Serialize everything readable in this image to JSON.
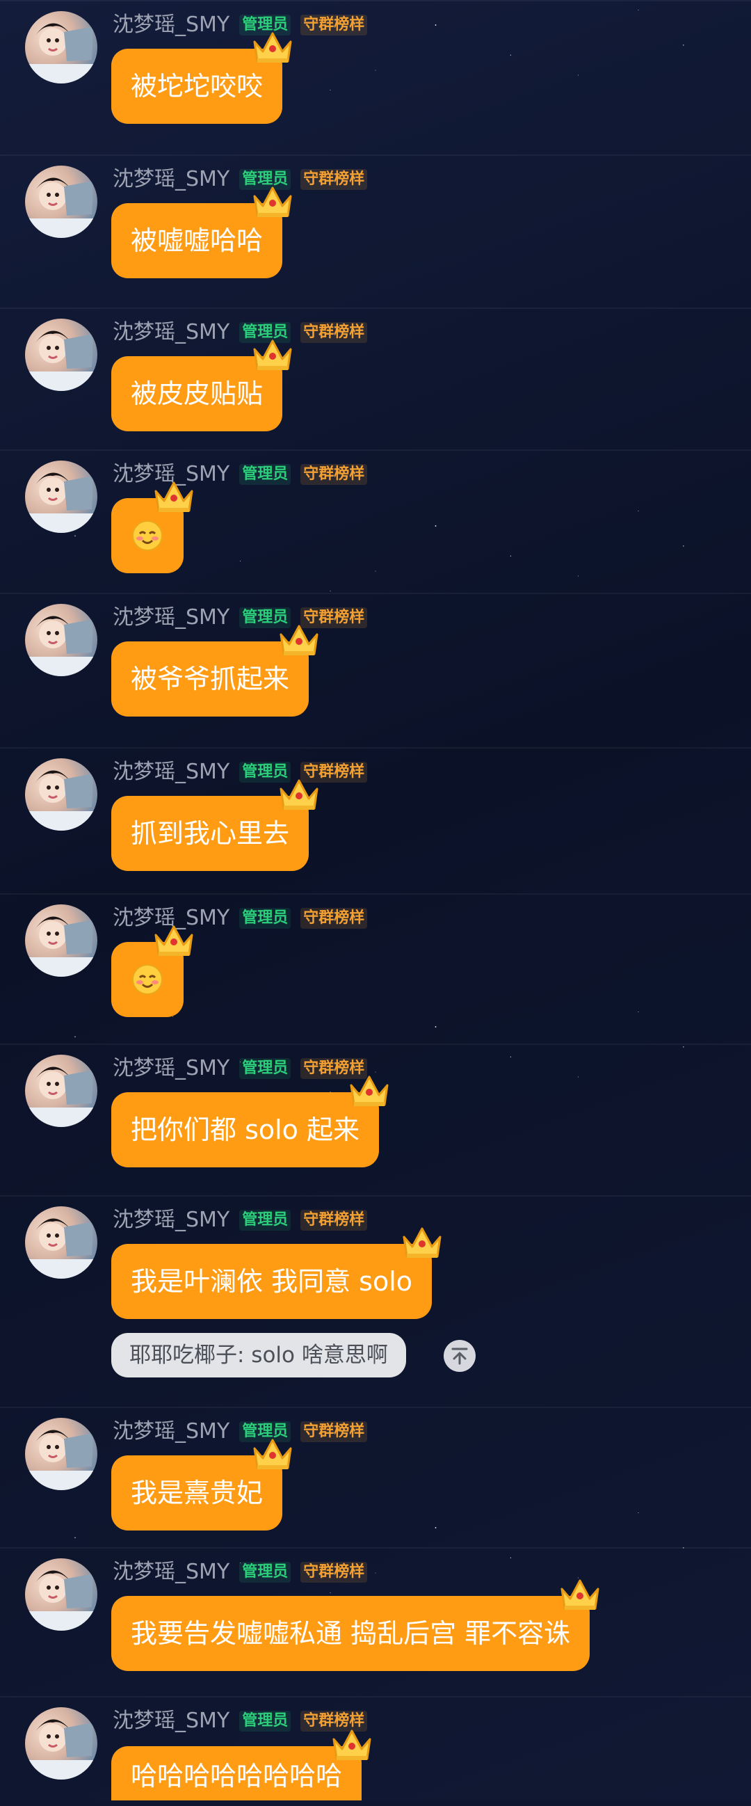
{
  "sender": {
    "name": "沈梦瑶_SMY",
    "badge_admin": "管理员",
    "badge_guard": "守群榜样"
  },
  "messages": [
    {
      "text": "被坨坨咬咬",
      "emoji": null
    },
    {
      "text": "被嘘嘘哈哈",
      "emoji": null
    },
    {
      "text": "被皮皮贴贴",
      "emoji": null
    },
    {
      "text": "",
      "emoji": "smiling-blush-emoji"
    },
    {
      "text": "被爷爷抓起来",
      "emoji": null
    },
    {
      "text": "抓到我心里去",
      "emoji": null
    },
    {
      "text": "",
      "emoji": "smiling-blush-emoji"
    },
    {
      "text": "把你们都 solo 起来",
      "emoji": null
    },
    {
      "text": "我是叶澜依 我同意 solo",
      "emoji": null
    },
    {
      "text": "我是熹贵妃",
      "emoji": null
    },
    {
      "text": "我要告发嘘嘘私通 捣乱后宫 罪不容诛",
      "emoji": null
    },
    {
      "text": "哈哈哈哈哈哈哈哈",
      "emoji": null
    }
  ],
  "reply": {
    "text": "耶耶吃椰子: solo 啥意思啊",
    "icon": "scroll-to-top-icon"
  },
  "colors": {
    "bubble": "#ff9c14",
    "bubble_text": "#ffffff",
    "name": "#9ea3b3",
    "admin_badge": "#2bcf7a",
    "guard_badge": "#f3a032",
    "background": "#0e1630",
    "reply_bg": "#e3e4e8"
  },
  "icons": {
    "crown": "crown-icon",
    "avatar": "user-avatar"
  }
}
